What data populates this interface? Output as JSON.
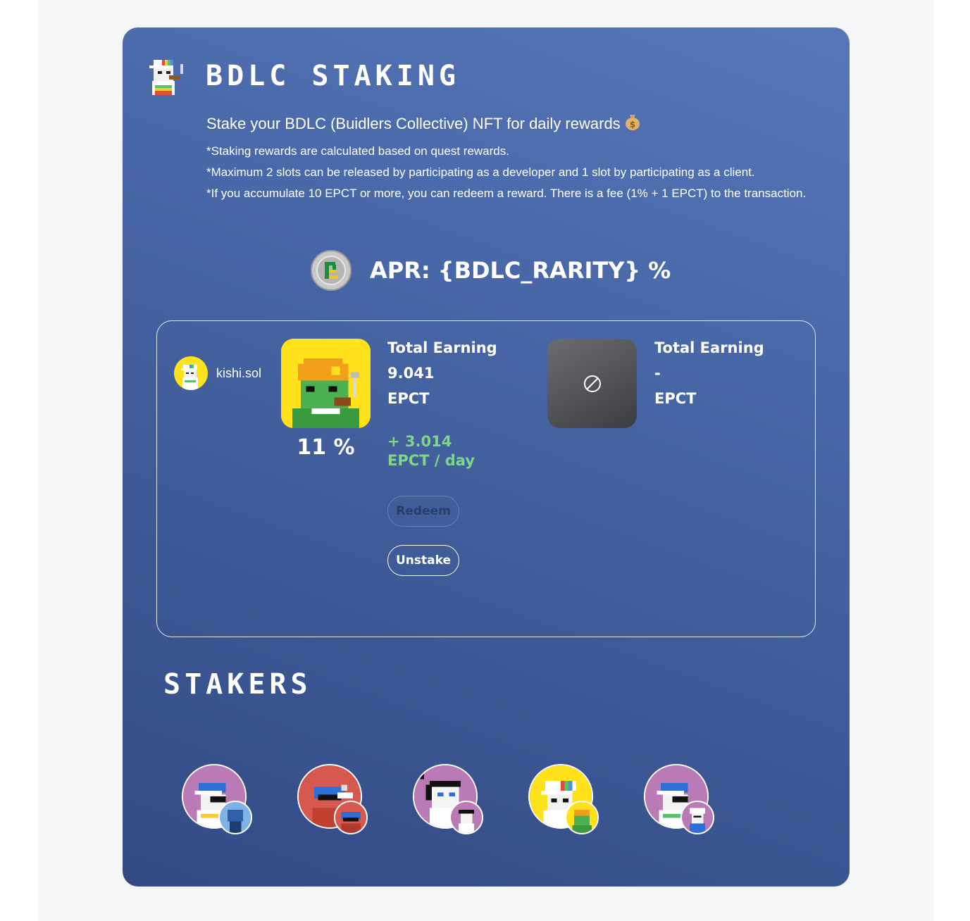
{
  "header": {
    "title": "BDLC STAKING",
    "subtitle": "Stake your BDLC (Buidlers Collective) NFT for daily rewards",
    "subtitle_icon": "money-bag-icon",
    "notes": [
      "*Staking rewards are calculated based on quest rewards.",
      "*Maximum 2 slots can be released by participating as a developer and 1 slot by participating as a client.",
      "*If you accumulate 10 EPCT or more, you can redeem a reward. There is a fee (1% + 1 EPCT) to the transaction."
    ]
  },
  "apr": {
    "text": "APR: {BDLC_RARITY} %",
    "coin_icon": "epct-coin-icon"
  },
  "user": {
    "name": "kishi.sol"
  },
  "slot1": {
    "rarity": "11 %",
    "earning_label": "Total Earning",
    "earning_value": "9.041",
    "earning_unit": "EPCT",
    "daily_amount": "+ 3.014",
    "daily_unit": "EPCT / day",
    "redeem_label": "Redeem",
    "unstake_label": "Unstake"
  },
  "slot2": {
    "empty_icon": "prohibited-icon",
    "earning_label": "Total Earning",
    "earning_value": "-",
    "earning_unit": "EPCT"
  },
  "stakers": {
    "title": "STAKERS",
    "count": 5
  },
  "colors": {
    "card_top": "#5677b9",
    "card_bottom": "#334a85",
    "daily_green": "#7fd68a",
    "nft_yellow": "#ffe21b",
    "avatar_purple": "#b97ab5",
    "avatar_red": "#d6584e"
  }
}
